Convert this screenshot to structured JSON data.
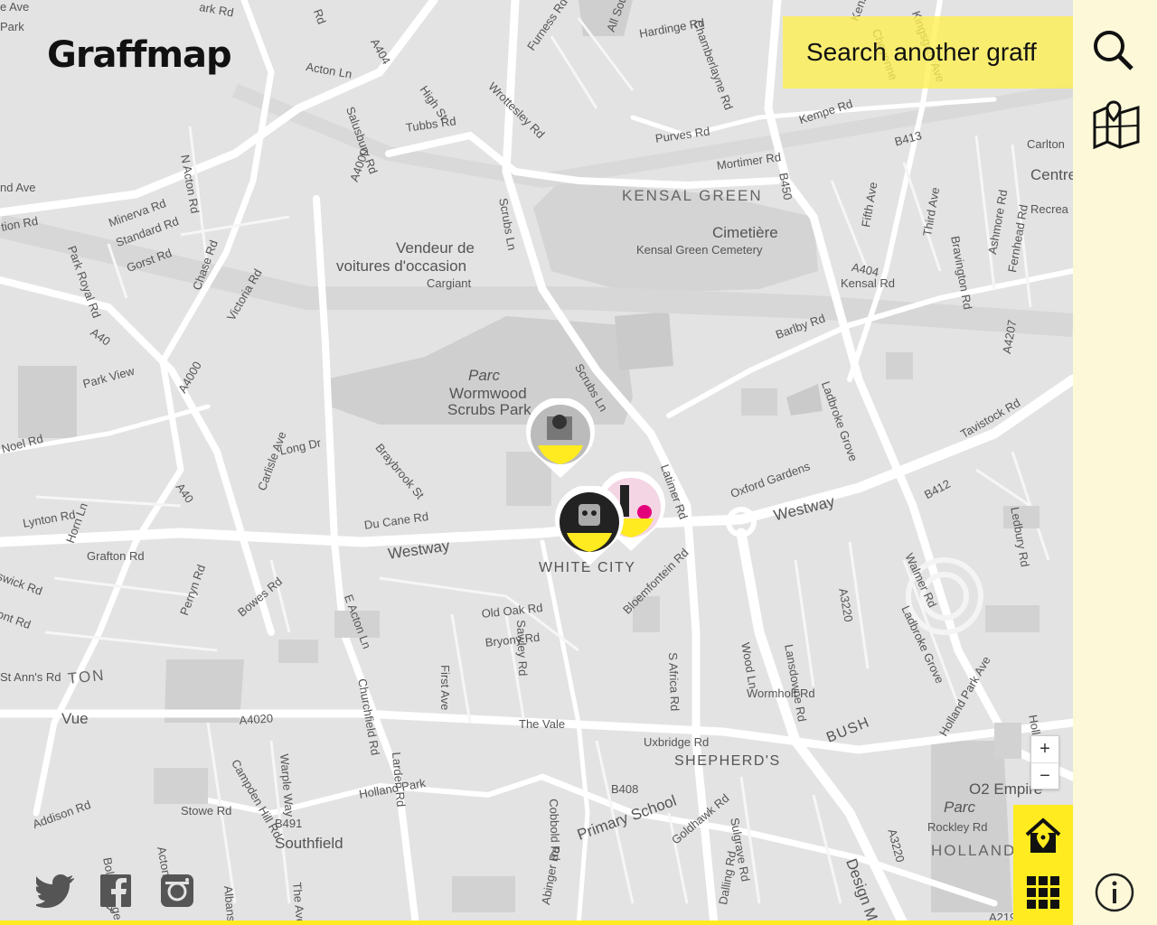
{
  "app": {
    "logo": "Graffmap"
  },
  "search": {
    "placeholder_text": "Search another graff"
  },
  "map_labels": [
    {
      "text": "Park",
      "cls": ""
    },
    {
      "text": "Acton Ln",
      "cls": ""
    },
    {
      "text": "A404",
      "cls": ""
    },
    {
      "text": "High St",
      "cls": ""
    },
    {
      "text": "Tubbs Rd",
      "cls": ""
    },
    {
      "text": "Furness Rd",
      "cls": ""
    },
    {
      "text": "Wrottesley Rd",
      "cls": ""
    },
    {
      "text": "All Souls Ave",
      "cls": ""
    },
    {
      "text": "Hardinge Rd",
      "cls": ""
    },
    {
      "text": "Chamberlayne Rd",
      "cls": ""
    },
    {
      "text": "Purves Rd",
      "cls": ""
    },
    {
      "text": "Kempe Rd",
      "cls": ""
    },
    {
      "text": "Mortimer Rd",
      "cls": ""
    },
    {
      "text": "B413",
      "cls": ""
    },
    {
      "text": "B450",
      "cls": ""
    },
    {
      "text": "Carlton",
      "cls": ""
    },
    {
      "text": "Centre",
      "cls": "place"
    },
    {
      "text": "Recrea",
      "cls": ""
    },
    {
      "text": "KENSAL GREEN",
      "cls": "area"
    },
    {
      "text": "Cimetière",
      "cls": "place"
    },
    {
      "text": "Kensal Green Cemetery",
      "cls": ""
    },
    {
      "text": "A404",
      "cls": ""
    },
    {
      "text": "Kensal Rd",
      "cls": ""
    },
    {
      "text": "Fifth Ave",
      "cls": ""
    },
    {
      "text": "Third Ave",
      "cls": ""
    },
    {
      "text": "Bravington Rd",
      "cls": ""
    },
    {
      "text": "Ashmore Rd",
      "cls": ""
    },
    {
      "text": "Fernhead Rd",
      "cls": ""
    },
    {
      "text": "N Acton Rd",
      "cls": ""
    },
    {
      "text": "nd Ave",
      "cls": ""
    },
    {
      "text": "tion Rd",
      "cls": ""
    },
    {
      "text": "Minerva Rd",
      "cls": ""
    },
    {
      "text": "Standard Rd",
      "cls": ""
    },
    {
      "text": "Gorst Rd",
      "cls": ""
    },
    {
      "text": "Park Royal Rd",
      "cls": ""
    },
    {
      "text": "Chase Rd",
      "cls": ""
    },
    {
      "text": "Victoria Rd",
      "cls": ""
    },
    {
      "text": "A4000",
      "cls": ""
    },
    {
      "text": "Vendeur de",
      "cls": "place"
    },
    {
      "text": "voitures d'occasion",
      "cls": "place"
    },
    {
      "text": "Cargiant",
      "cls": ""
    },
    {
      "text": "Scrubs Ln",
      "cls": ""
    },
    {
      "text": "A40",
      "cls": ""
    },
    {
      "text": "Park View",
      "cls": ""
    },
    {
      "text": "A4000",
      "cls": ""
    },
    {
      "text": "Parc",
      "cls": "place italic"
    },
    {
      "text": "Wormwood",
      "cls": "place"
    },
    {
      "text": "Scrubs Park",
      "cls": "place"
    },
    {
      "text": "Scrubs Ln",
      "cls": ""
    },
    {
      "text": "Barlby Rd",
      "cls": ""
    },
    {
      "text": "Ladbroke Grove",
      "cls": ""
    },
    {
      "text": "A4207",
      "cls": ""
    },
    {
      "text": "Tavistock Rd",
      "cls": ""
    },
    {
      "text": "Noel Rd",
      "cls": ""
    },
    {
      "text": "Long Dr",
      "cls": ""
    },
    {
      "text": "Braybrook St",
      "cls": ""
    },
    {
      "text": "A40",
      "cls": ""
    },
    {
      "text": "Latimer Rd",
      "cls": ""
    },
    {
      "text": "Oxford Gardens",
      "cls": ""
    },
    {
      "text": "Westway",
      "cls": "place"
    },
    {
      "text": "B412",
      "cls": ""
    },
    {
      "text": "Ledbury Rd",
      "cls": ""
    },
    {
      "text": "Lynton Rd",
      "cls": ""
    },
    {
      "text": "Horn Ln",
      "cls": ""
    },
    {
      "text": "Carlisle Ave",
      "cls": ""
    },
    {
      "text": "Du Cane Rd",
      "cls": ""
    },
    {
      "text": "Grafton Rd",
      "cls": ""
    },
    {
      "text": "Westway",
      "cls": "place"
    },
    {
      "text": "WHITE CITY",
      "cls": "big"
    },
    {
      "text": "swick Rd",
      "cls": ""
    },
    {
      "text": "ont Rd",
      "cls": ""
    },
    {
      "text": "Perryn Rd",
      "cls": ""
    },
    {
      "text": "Bowes Rd",
      "cls": ""
    },
    {
      "text": "E Acton Ln",
      "cls": ""
    },
    {
      "text": "Old Oak Rd",
      "cls": ""
    },
    {
      "text": "Bryony Rd",
      "cls": ""
    },
    {
      "text": "Sawley Rd",
      "cls": ""
    },
    {
      "text": "Bloemfontein Rd",
      "cls": ""
    },
    {
      "text": "S Africa Rd",
      "cls": ""
    },
    {
      "text": "Wood Ln",
      "cls": ""
    },
    {
      "text": "A3220",
      "cls": ""
    },
    {
      "text": "Walmer Rd",
      "cls": ""
    },
    {
      "text": "Ladbroke Grove",
      "cls": ""
    },
    {
      "text": "Lansdowne Rd",
      "cls": ""
    },
    {
      "text": "St Ann's Rd",
      "cls": ""
    },
    {
      "text": "TON",
      "cls": "area"
    },
    {
      "text": "Churchfield Rd",
      "cls": ""
    },
    {
      "text": "First Ave",
      "cls": ""
    },
    {
      "text": "Wormholt Rd",
      "cls": ""
    },
    {
      "text": "Vue",
      "cls": "place"
    },
    {
      "text": "A4020",
      "cls": ""
    },
    {
      "text": "The Vale",
      "cls": ""
    },
    {
      "text": "Uxbridge Rd",
      "cls": ""
    },
    {
      "text": "SHEPHERD'S",
      "cls": "big"
    },
    {
      "text": "BUSH",
      "cls": "big"
    },
    {
      "text": "Holland Park Ave",
      "cls": ""
    },
    {
      "text": "Holland Park",
      "cls": ""
    },
    {
      "text": "Campden Hill Rd",
      "cls": ""
    },
    {
      "text": "Warple Way",
      "cls": ""
    },
    {
      "text": "Larden Rd",
      "cls": ""
    },
    {
      "text": "B408",
      "cls": ""
    },
    {
      "text": "O2 Empire",
      "cls": "place"
    },
    {
      "text": "Parc",
      "cls": "place italic"
    },
    {
      "text": "Holland Park",
      "cls": ""
    },
    {
      "text": "Cobbold Rd",
      "cls": ""
    },
    {
      "text": "Stowe Rd",
      "cls": ""
    },
    {
      "text": "B491",
      "cls": ""
    },
    {
      "text": "Southfield",
      "cls": "place"
    },
    {
      "text": "Primary School",
      "cls": "place"
    },
    {
      "text": "Goldhawk Rd",
      "cls": ""
    },
    {
      "text": "Sulgrave Rd",
      "cls": ""
    },
    {
      "text": "Rockley Rd",
      "cls": ""
    },
    {
      "text": "HOLLAND",
      "cls": "area"
    },
    {
      "text": "Design Mu",
      "cls": "place"
    },
    {
      "text": "A3220",
      "cls": ""
    },
    {
      "text": "Addison Rd",
      "cls": ""
    },
    {
      "text": "Bollo Bridge Rd",
      "cls": ""
    },
    {
      "text": "Acton Ln",
      "cls": ""
    },
    {
      "text": "Albans Ave",
      "cls": ""
    },
    {
      "text": "The Avenue",
      "cls": ""
    },
    {
      "text": "Abinger Rd",
      "cls": ""
    },
    {
      "text": "Dalling Rd",
      "cls": ""
    },
    {
      "text": "A219",
      "cls": ""
    },
    {
      "text": "Kensi",
      "cls": ""
    },
    {
      "text": "Cheyenne",
      "cls": ""
    },
    {
      "text": "Kingsgate Ave",
      "cls": ""
    },
    {
      "text": "Salusbury Rd",
      "cls": ""
    },
    {
      "text": "A4000",
      "cls": ""
    },
    {
      "text": "Rd",
      "cls": ""
    },
    {
      "text": "ark Rd",
      "cls": ""
    },
    {
      "text": "e Ave",
      "cls": ""
    }
  ],
  "controls": {
    "zoom_in": "+",
    "zoom_out": "−"
  },
  "social": [
    "twitter-icon",
    "facebook-icon",
    "instagram-icon"
  ],
  "colors": {
    "accent": "#ffeb1f",
    "sidebar": "#fdf8d8",
    "map": "#e3e3e3",
    "road": "#ffffff"
  }
}
